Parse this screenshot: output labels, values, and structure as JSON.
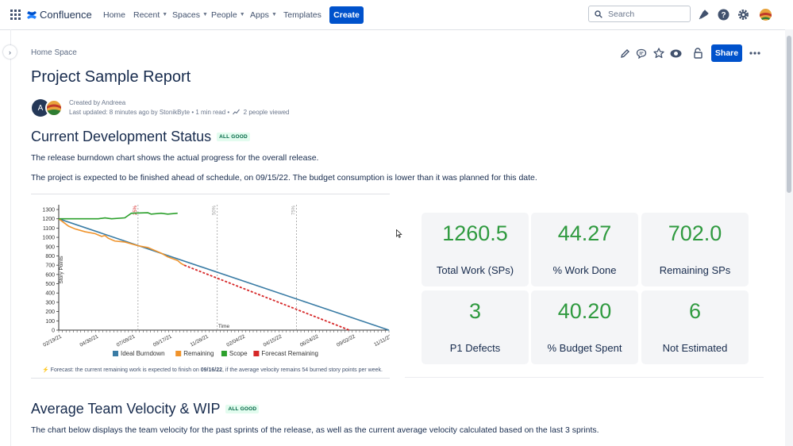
{
  "colors": {
    "brand": "#0052cc",
    "good": "#2f9a3f",
    "ideal": "#3a7ca5",
    "remaining": "#f0932b",
    "scope": "#2ca02c",
    "forecast": "#d62728"
  },
  "topbar": {
    "product": "Confluence",
    "nav": [
      {
        "label": "Home",
        "caret": false
      },
      {
        "label": "Recent",
        "caret": true
      },
      {
        "label": "Spaces",
        "caret": true
      },
      {
        "label": "People",
        "caret": true
      },
      {
        "label": "Apps",
        "caret": true
      },
      {
        "label": "Templates",
        "caret": false
      }
    ],
    "create_label": "Create",
    "search_placeholder": "Search",
    "icons": [
      "app-switcher-icon",
      "notifications-icon",
      "help-icon",
      "settings-icon",
      "profile-avatar"
    ]
  },
  "page": {
    "breadcrumb": "Home Space",
    "share_label": "Share",
    "title": "Project Sample Report",
    "created_by": "Created by Andreea",
    "last_updated": "Last updated: 8 minutes ago by StonikByte",
    "read_time": "1 min read",
    "viewed": "2 people viewed",
    "avatar_initial": "A"
  },
  "section1": {
    "heading": "Current Development Status",
    "status": "ALL GOOD",
    "para1": "The release burndown chart shows the actual progress for the overall release.",
    "para2": "The project is expected to be finished ahead of schedule, on 09/15/22. The budget consumption is lower than it was planned for this date."
  },
  "chart_data": {
    "type": "line",
    "ylabel": "Story Points",
    "xlabel": "Time",
    "ylim": [
      0,
      1300
    ],
    "yticks": [
      0,
      100,
      200,
      300,
      400,
      500,
      600,
      700,
      800,
      900,
      1000,
      1100,
      1200,
      1300
    ],
    "xtick_labels": [
      "02/19/21",
      "04/30/21",
      "07/09/21",
      "09/17/21",
      "11/26/21",
      "02/04/22",
      "04/15/22",
      "06/24/22",
      "09/02/22",
      "11/11/22"
    ],
    "markers": [
      {
        "label": "25%",
        "color": "#d62728",
        "x": 0.24
      },
      {
        "label": "50%",
        "color": "#9e9e9e",
        "x": 0.48
      },
      {
        "label": "75%",
        "color": "#9e9e9e",
        "x": 0.72
      }
    ],
    "series": [
      {
        "name": "Ideal Burndown",
        "color": "#3a7ca5",
        "dash": false,
        "points": [
          [
            0,
            1200
          ],
          [
            1,
            0
          ]
        ]
      },
      {
        "name": "Remaining",
        "color": "#f0932b",
        "dash": false,
        "points": [
          [
            0,
            1200
          ],
          [
            0.03,
            1120
          ],
          [
            0.05,
            1090
          ],
          [
            0.08,
            1060
          ],
          [
            0.11,
            1040
          ],
          [
            0.13,
            1010
          ],
          [
            0.14,
            1020
          ],
          [
            0.15,
            990
          ],
          [
            0.17,
            960
          ],
          [
            0.2,
            950
          ],
          [
            0.24,
            910
          ],
          [
            0.27,
            890
          ],
          [
            0.29,
            860
          ],
          [
            0.31,
            830
          ],
          [
            0.33,
            790
          ],
          [
            0.36,
            750
          ],
          [
            0.37,
            720
          ],
          [
            0.38,
            700
          ]
        ]
      },
      {
        "name": "Scope",
        "color": "#2ca02c",
        "dash": false,
        "points": [
          [
            0,
            1200
          ],
          [
            0.12,
            1200
          ],
          [
            0.14,
            1210
          ],
          [
            0.16,
            1200
          ],
          [
            0.2,
            1210
          ],
          [
            0.22,
            1260
          ],
          [
            0.27,
            1265
          ],
          [
            0.28,
            1250
          ],
          [
            0.31,
            1260
          ],
          [
            0.33,
            1250
          ],
          [
            0.36,
            1260
          ]
        ]
      },
      {
        "name": "Forecast Remaining",
        "color": "#d62728",
        "dash": true,
        "points": [
          [
            0.38,
            700
          ],
          [
            0.88,
            0
          ]
        ]
      }
    ]
  },
  "forecast_note": {
    "prefix": "Forecast: the current remaining work is expected to finish on ",
    "date": "09/16/22",
    "suffix": ", if the average velocity remains 54 burned story points per week."
  },
  "stats": [
    {
      "value": "1260.5",
      "label": "Total Work (SPs)"
    },
    {
      "value": "44.27",
      "label": "% Work Done"
    },
    {
      "value": "702.0",
      "label": "Remaining SPs"
    },
    {
      "value": "3",
      "label": "P1 Defects"
    },
    {
      "value": "40.20",
      "label": "% Budget Spent"
    },
    {
      "value": "6",
      "label": "Not Estimated"
    }
  ],
  "section2": {
    "heading": "Average Team Velocity & WIP",
    "status": "ALL GOOD",
    "para": "The chart below displays the team velocity for the past sprints of the release, as well as the current average velocity calculated based on the last 3 sprints."
  }
}
